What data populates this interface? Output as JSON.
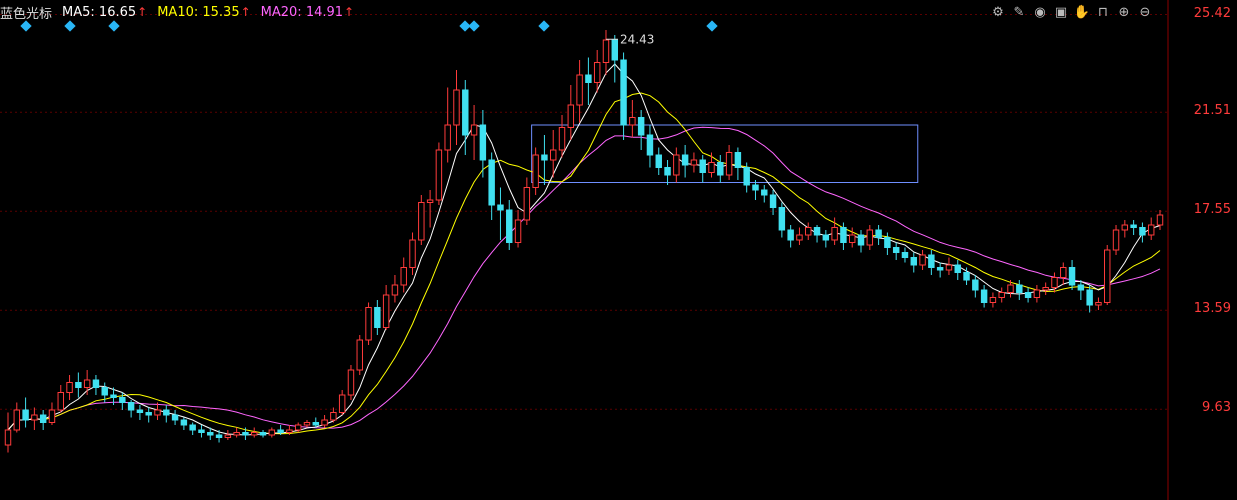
{
  "header": {
    "name": "蓝色光标",
    "ma5": {
      "label": "MA5:",
      "value": "16.65",
      "color": "#ffffff"
    },
    "ma10": {
      "label": "MA10:",
      "value": "15.35",
      "color": "#ffff00"
    },
    "ma20": {
      "label": "MA20:",
      "value": "14.91",
      "color": "#ff66ff"
    },
    "arrow": "↑"
  },
  "toolbar": [
    {
      "name": "settings-icon",
      "glyph": "⚙"
    },
    {
      "name": "pen-icon",
      "glyph": "✎"
    },
    {
      "name": "eye-icon",
      "glyph": "◉"
    },
    {
      "name": "box-icon",
      "glyph": "▣"
    },
    {
      "name": "hand-icon",
      "glyph": "✋"
    },
    {
      "name": "lock-icon",
      "glyph": "⊓"
    },
    {
      "name": "zoom-in-icon",
      "glyph": "⊕"
    },
    {
      "name": "zoom-out-icon",
      "glyph": "⊖"
    }
  ],
  "chart_data": {
    "type": "candlestick",
    "ylim": [
      6.0,
      26.0
    ],
    "y_tick_labels": [
      "25.42",
      "21.51",
      "17.55",
      "13.59",
      "9.63"
    ],
    "y_ticks": [
      25.42,
      21.51,
      17.55,
      13.59,
      9.63
    ],
    "peak_label": "24.43",
    "peak_value": 24.43,
    "highlight_box": {
      "x_index_start": 60,
      "x_index_end": 103,
      "y_low": 18.7,
      "y_high": 21.0
    },
    "marker_indices": [
      2,
      7,
      12,
      52,
      53,
      61,
      80,
      149
    ],
    "ma_colors": {
      "ma5": "#ffffff",
      "ma10": "#ffff00",
      "ma20": "#ff66ff"
    },
    "up_color": "#ff3b3b",
    "down_color": "#40e0f0",
    "candles": [
      [
        8.2,
        8.8,
        7.9,
        9.5
      ],
      [
        8.8,
        9.6,
        8.7,
        9.9
      ],
      [
        9.6,
        9.2,
        8.9,
        10.1
      ],
      [
        9.2,
        9.4,
        8.8,
        9.7
      ],
      [
        9.4,
        9.1,
        8.8,
        9.6
      ],
      [
        9.1,
        9.6,
        9.0,
        9.9
      ],
      [
        9.6,
        10.3,
        9.5,
        10.6
      ],
      [
        10.3,
        10.7,
        10.0,
        11.0
      ],
      [
        10.7,
        10.5,
        10.1,
        11.1
      ],
      [
        10.5,
        10.8,
        10.2,
        11.2
      ],
      [
        10.8,
        10.5,
        10.2,
        11.0
      ],
      [
        10.5,
        10.2,
        9.9,
        10.7
      ],
      [
        10.2,
        10.1,
        9.8,
        10.5
      ],
      [
        10.1,
        9.9,
        9.6,
        10.3
      ],
      [
        9.9,
        9.6,
        9.3,
        10.0
      ],
      [
        9.6,
        9.5,
        9.2,
        9.8
      ],
      [
        9.5,
        9.4,
        9.1,
        9.7
      ],
      [
        9.4,
        9.6,
        9.2,
        9.9
      ],
      [
        9.6,
        9.4,
        9.1,
        9.8
      ],
      [
        9.4,
        9.2,
        9.0,
        9.6
      ],
      [
        9.2,
        9.0,
        8.8,
        9.3
      ],
      [
        9.0,
        8.8,
        8.6,
        9.1
      ],
      [
        8.8,
        8.7,
        8.5,
        9.0
      ],
      [
        8.7,
        8.6,
        8.4,
        8.9
      ],
      [
        8.6,
        8.5,
        8.3,
        8.8
      ],
      [
        8.5,
        8.6,
        8.4,
        8.8
      ],
      [
        8.6,
        8.7,
        8.5,
        8.9
      ],
      [
        8.7,
        8.6,
        8.4,
        8.9
      ],
      [
        8.6,
        8.7,
        8.5,
        8.9
      ],
      [
        8.7,
        8.6,
        8.5,
        8.8
      ],
      [
        8.6,
        8.8,
        8.5,
        8.9
      ],
      [
        8.8,
        8.7,
        8.6,
        9.0
      ],
      [
        8.7,
        8.8,
        8.6,
        9.0
      ],
      [
        8.8,
        9.0,
        8.7,
        9.1
      ],
      [
        9.0,
        9.1,
        8.9,
        9.2
      ],
      [
        9.1,
        9.0,
        8.9,
        9.3
      ],
      [
        9.0,
        9.2,
        8.9,
        9.4
      ],
      [
        9.2,
        9.5,
        9.1,
        9.7
      ],
      [
        9.5,
        10.2,
        9.4,
        10.4
      ],
      [
        10.2,
        11.2,
        10.0,
        11.4
      ],
      [
        11.2,
        12.4,
        11.0,
        12.6
      ],
      [
        12.4,
        13.7,
        12.2,
        13.9
      ],
      [
        13.7,
        12.9,
        12.6,
        14.0
      ],
      [
        12.9,
        14.2,
        12.8,
        14.6
      ],
      [
        14.2,
        14.6,
        13.9,
        15.0
      ],
      [
        14.6,
        15.3,
        14.3,
        15.7
      ],
      [
        15.3,
        16.4,
        15.0,
        16.7
      ],
      [
        16.4,
        17.9,
        16.2,
        18.2
      ],
      [
        17.9,
        18.0,
        16.9,
        18.4
      ],
      [
        18.0,
        20.0,
        17.8,
        20.3
      ],
      [
        20.0,
        21.0,
        19.5,
        22.5
      ],
      [
        21.0,
        22.4,
        20.2,
        23.2
      ],
      [
        22.4,
        20.6,
        19.8,
        22.8
      ],
      [
        20.6,
        21.0,
        19.6,
        21.8
      ],
      [
        21.0,
        19.6,
        18.9,
        21.6
      ],
      [
        19.6,
        17.8,
        17.2,
        19.9
      ],
      [
        17.8,
        17.6,
        16.4,
        18.5
      ],
      [
        17.6,
        16.3,
        16.0,
        18.0
      ],
      [
        16.3,
        17.2,
        16.1,
        17.6
      ],
      [
        17.2,
        18.5,
        17.0,
        18.9
      ],
      [
        18.5,
        19.8,
        18.2,
        20.1
      ],
      [
        19.8,
        19.6,
        18.6,
        20.6
      ],
      [
        19.6,
        20.0,
        18.9,
        20.8
      ],
      [
        20.0,
        20.9,
        19.7,
        21.4
      ],
      [
        20.9,
        21.8,
        20.4,
        22.6
      ],
      [
        21.8,
        23.0,
        21.1,
        23.6
      ],
      [
        23.0,
        22.7,
        21.8,
        23.7
      ],
      [
        22.7,
        23.5,
        22.3,
        24.0
      ],
      [
        23.5,
        24.4,
        23.0,
        24.8
      ],
      [
        24.4,
        23.6,
        22.7,
        24.6
      ],
      [
        23.6,
        21.0,
        20.4,
        23.9
      ],
      [
        21.0,
        21.3,
        20.5,
        22.0
      ],
      [
        21.3,
        20.6,
        20.0,
        21.6
      ],
      [
        20.6,
        19.8,
        19.3,
        21.0
      ],
      [
        19.8,
        19.3,
        19.0,
        20.1
      ],
      [
        19.3,
        19.0,
        18.6,
        19.6
      ],
      [
        19.0,
        19.8,
        18.7,
        20.1
      ],
      [
        19.8,
        19.4,
        18.9,
        20.2
      ],
      [
        19.4,
        19.6,
        19.1,
        19.9
      ],
      [
        19.6,
        19.1,
        18.7,
        19.8
      ],
      [
        19.1,
        19.5,
        18.9,
        19.9
      ],
      [
        19.5,
        19.0,
        18.7,
        19.8
      ],
      [
        19.0,
        19.9,
        18.8,
        20.2
      ],
      [
        19.9,
        19.3,
        18.8,
        20.1
      ],
      [
        19.3,
        18.6,
        18.3,
        19.5
      ],
      [
        18.6,
        18.4,
        18.0,
        18.8
      ],
      [
        18.4,
        18.2,
        17.9,
        18.6
      ],
      [
        18.2,
        17.7,
        17.4,
        18.4
      ],
      [
        17.7,
        16.8,
        16.5,
        17.9
      ],
      [
        16.8,
        16.4,
        16.1,
        17.0
      ],
      [
        16.4,
        16.6,
        16.2,
        16.9
      ],
      [
        16.6,
        16.9,
        16.4,
        17.1
      ],
      [
        16.9,
        16.6,
        16.3,
        17.0
      ],
      [
        16.6,
        16.4,
        16.1,
        16.8
      ],
      [
        16.4,
        16.9,
        16.2,
        17.3
      ],
      [
        16.9,
        16.3,
        16.0,
        17.1
      ],
      [
        16.3,
        16.6,
        16.1,
        16.9
      ],
      [
        16.6,
        16.2,
        15.9,
        16.8
      ],
      [
        16.2,
        16.8,
        16.0,
        17.0
      ],
      [
        16.8,
        16.5,
        16.2,
        17.0
      ],
      [
        16.5,
        16.1,
        15.8,
        16.7
      ],
      [
        16.1,
        15.9,
        15.6,
        16.3
      ],
      [
        15.9,
        15.7,
        15.5,
        16.1
      ],
      [
        15.7,
        15.4,
        15.1,
        15.9
      ],
      [
        15.4,
        15.8,
        15.2,
        16.0
      ],
      [
        15.8,
        15.3,
        15.0,
        16.0
      ],
      [
        15.3,
        15.2,
        14.9,
        15.5
      ],
      [
        15.2,
        15.4,
        15.0,
        15.7
      ],
      [
        15.4,
        15.1,
        14.8,
        15.6
      ],
      [
        15.1,
        14.8,
        14.6,
        15.3
      ],
      [
        14.8,
        14.4,
        14.1,
        15.0
      ],
      [
        14.4,
        13.9,
        13.7,
        14.6
      ],
      [
        13.9,
        14.1,
        13.7,
        14.3
      ],
      [
        14.1,
        14.3,
        13.9,
        14.5
      ],
      [
        14.3,
        14.6,
        14.1,
        14.8
      ],
      [
        14.6,
        14.3,
        14.0,
        14.8
      ],
      [
        14.3,
        14.1,
        13.9,
        14.5
      ],
      [
        14.1,
        14.4,
        13.9,
        14.6
      ],
      [
        14.4,
        14.5,
        14.2,
        14.7
      ],
      [
        14.5,
        14.9,
        14.3,
        15.1
      ],
      [
        14.9,
        15.3,
        14.6,
        15.5
      ],
      [
        15.3,
        14.6,
        14.4,
        15.6
      ],
      [
        14.6,
        14.4,
        14.0,
        14.8
      ],
      [
        14.4,
        13.8,
        13.5,
        14.6
      ],
      [
        13.8,
        13.9,
        13.6,
        14.1
      ],
      [
        13.9,
        16.0,
        13.8,
        16.2
      ],
      [
        16.0,
        16.8,
        15.8,
        17.0
      ],
      [
        16.8,
        17.0,
        16.5,
        17.2
      ],
      [
        17.0,
        16.9,
        16.6,
        17.2
      ],
      [
        16.9,
        16.6,
        16.3,
        17.1
      ],
      [
        16.6,
        17.0,
        16.4,
        17.3
      ],
      [
        17.0,
        17.4,
        16.8,
        17.6
      ]
    ]
  }
}
